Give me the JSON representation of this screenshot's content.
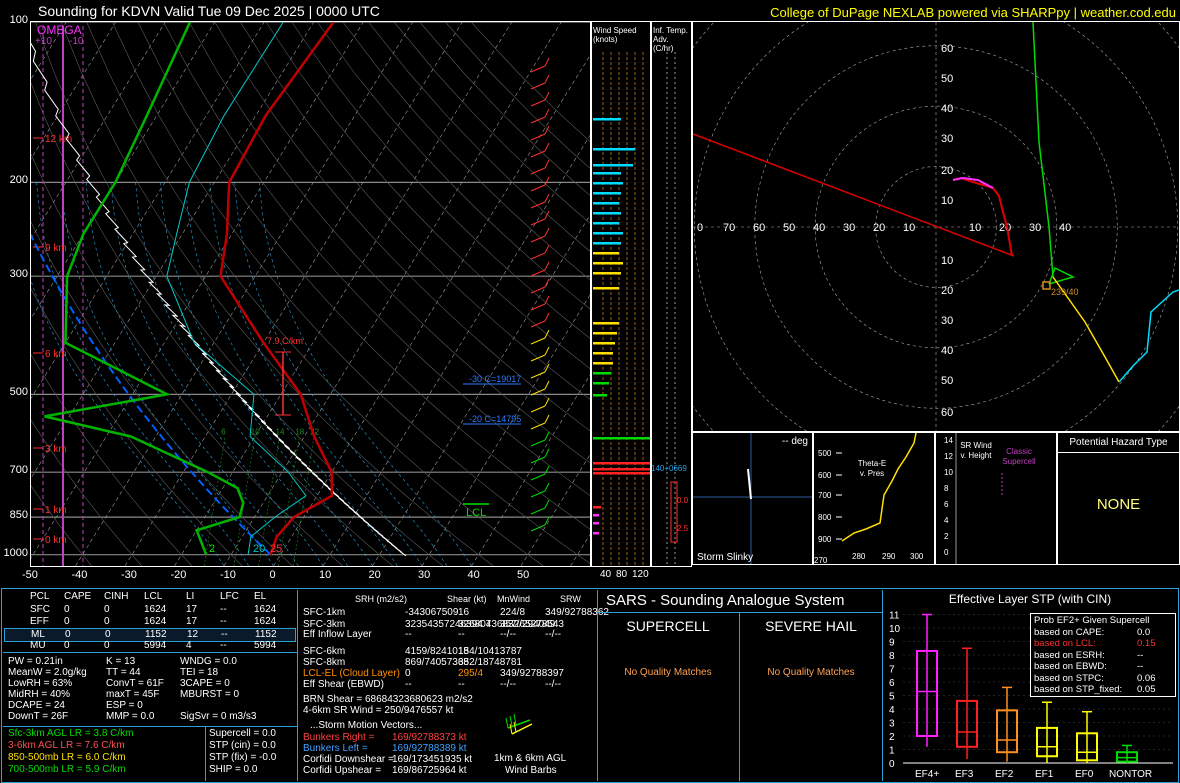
{
  "header": {
    "title": "Sounding for KDVN Valid  Tue 09 Dec 2025 | 0000 UTC",
    "credit": "College of DuPage NEXLAB powered via SHARPpy | weather.cod.edu"
  },
  "colors": {
    "temp": "#c00000",
    "dew": "#00b400",
    "wetbulb": "#00c8c8",
    "parcel": "#ffffff",
    "virtual": "#0060ff",
    "hodo_red": "#e00000",
    "hodo_magenta": "#ff30ff",
    "hodo_green": "#00dc00",
    "hodo_yellow": "#ffe000",
    "hodo_cyan": "#00dcff",
    "omega": "#c040c0",
    "credit": "#ffff00",
    "panel_border": "#2aa0d8"
  },
  "skewt": {
    "pressure_levels": [
      100,
      200,
      300,
      500,
      700,
      850,
      1000
    ],
    "pressure_labels": [
      "100",
      "200",
      "300",
      "500",
      "700",
      "850",
      "1000"
    ],
    "temp_ticks": [
      "-50",
      "-40",
      "-30",
      "-20",
      "-10",
      "0",
      "10",
      "20",
      "30",
      "40",
      "50"
    ],
    "height_labels": [
      "12 km",
      "9 km",
      "6 km",
      "3 km",
      "1 km",
      "0 km"
    ],
    "omega_label": "OMEGA",
    "omega_ticks": [
      "+10",
      "-10"
    ],
    "annotations": {
      "lapse": "7.9 C/km",
      "minus30": "-30 C=19017",
      "minus20": "-20 C=14795",
      "lcl": "LCL",
      "sfc_dew": "2",
      "sfc_wb": "20",
      "sfc_temp": "25"
    },
    "mixing_ratio_labels": [
      "6",
      "10",
      "14",
      "18",
      "22"
    ],
    "temperature": [
      [
        100,
        -56
      ],
      [
        150,
        -58
      ],
      [
        200,
        -57
      ],
      [
        250,
        -51
      ],
      [
        300,
        -47
      ],
      [
        400,
        -30
      ],
      [
        500,
        -16
      ],
      [
        600,
        -8
      ],
      [
        700,
        0
      ],
      [
        775,
        3
      ],
      [
        850,
        -2
      ],
      [
        925,
        -3
      ],
      [
        1000,
        -2
      ]
    ],
    "dewpoint": [
      [
        100,
        -85
      ],
      [
        150,
        -82
      ],
      [
        200,
        -80
      ],
      [
        250,
        -80
      ],
      [
        300,
        -78
      ],
      [
        400,
        -70
      ],
      [
        500,
        -43
      ],
      [
        550,
        -65
      ],
      [
        600,
        -45
      ],
      [
        700,
        -25
      ],
      [
        750,
        -17
      ],
      [
        800,
        -14
      ],
      [
        850,
        -13
      ],
      [
        900,
        -20
      ],
      [
        1000,
        -15
      ]
    ]
  },
  "side_strips": {
    "wind_speed_title": "Wind Speed (knots)",
    "wind_speed_ticks": [
      "40",
      "80",
      "120"
    ],
    "inf_temp_title": "Inf. Temp. Adv. (C/hr)",
    "inf_values": [
      "140+0669",
      "0.0",
      "2.5"
    ]
  },
  "hodograph": {
    "rings": [
      10,
      20,
      30,
      40,
      50,
      60,
      70
    ],
    "x_labels": [
      "0",
      "70",
      "60",
      "50",
      "40",
      "30",
      "20",
      "10",
      "10",
      "20",
      "30",
      "40"
    ],
    "y_labels": [
      "60",
      "50",
      "40",
      "30",
      "20",
      "10",
      "10",
      "20",
      "30",
      "40",
      "50",
      "60"
    ],
    "storm_label": "239/40"
  },
  "slinky": {
    "title": "-- deg",
    "label": "Storm Slinky"
  },
  "theta": {
    "title": "Theta-E v. Pres",
    "y_ticks": [
      "500",
      "600",
      "700",
      "800",
      "900"
    ],
    "x_ticks": [
      "280",
      "290",
      "300"
    ],
    "y_bottom": "1000",
    "y_bottom_partial": "270"
  },
  "srwind": {
    "title": "SR Wind v. Height",
    "label": "Classic Supercell",
    "y_ticks": [
      "14",
      "12",
      "10",
      "8",
      "6",
      "4",
      "2",
      "0"
    ]
  },
  "hazard": {
    "title": "Potential Hazard Type",
    "value": "NONE"
  },
  "parcel_table": {
    "headers": [
      "PCL",
      "CAPE",
      "CINH",
      "LCL",
      "LI",
      "LFC",
      "EL"
    ],
    "rows": [
      [
        "SFC",
        "0",
        "0",
        "1624",
        "17",
        "--",
        "1624"
      ],
      [
        "EFF",
        "0",
        "0",
        "1624",
        "17",
        "--",
        "1624"
      ],
      [
        "ML",
        "0",
        "0",
        "1152",
        "12",
        "--",
        "1152"
      ],
      [
        "MU",
        "0",
        "0",
        "5994",
        "4",
        "--",
        "5994"
      ]
    ]
  },
  "indices": [
    [
      "PW = 0.21in",
      "K = 13",
      "WNDG = 0.0"
    ],
    [
      "MeanW = 2.0g/kg",
      "TT = 44",
      "TEI = 18"
    ],
    [
      "LowRH = 63%",
      "ConvT = 61F",
      "3CAPE = 0"
    ],
    [
      "MidRH = 40%",
      "maxT = 45F",
      "MBURST = 0"
    ],
    [
      "DCAPE = 24",
      "ESP = 0",
      ""
    ],
    [
      "DownT = 26F",
      "MMP = 0.0",
      "SigSvr = 0 m3/s3"
    ]
  ],
  "lapse_rates": [
    {
      "text": "Sfc-3km AGL LR = 3.8 C/km",
      "color": "#00dc00"
    },
    {
      "text": "3-6km AGL LR = 7.6 C/km",
      "color": "#ff5050"
    },
    {
      "text": "850-500mb LR = 6.0 C/km",
      "color": "#ffe000"
    },
    {
      "text": "700-500mb LR = 5.9 C/km",
      "color": "#00dc00"
    }
  ],
  "composites": [
    "Supercell = 0.0",
    "STP (cin) = 0.0",
    "STP (fix) = -0.0",
    "SHIP = 0.0"
  ],
  "kinematics": {
    "headers": [
      "SRH (m2/s2)",
      "Shear (kt)",
      "MnWind",
      "SRW"
    ],
    "rows": [
      {
        "label": "SFC-1km",
        "c1": "-343067509",
        "c2": "16",
        "c3": "224/8",
        "c4": "349/92788362",
        "color": "#ffffff"
      },
      {
        "label": "SFC-3km",
        "c1": "32354357246394 7",
        "c2": "32680436832/294049",
        "c3": "357/65278543",
        "c4": "",
        "color": "#ffffff"
      },
      {
        "label": "Eff Inflow Layer",
        "c1": "--",
        "c2": "--",
        "c3": "--/--",
        "c4": "--/--",
        "color": "#ffffff"
      },
      {
        "label": "SFC-6km",
        "c1": "4159/8241018",
        "c2": "154/10413787",
        "c3": "",
        "c4": "",
        "color": "#ffffff"
      },
      {
        "label": "SFC-8km",
        "c1": "869/74057368",
        "c2": "352/18748781",
        "c3": "",
        "c4": "",
        "color": "#ffffff"
      },
      {
        "label": "LCL-EL (Cloud Layer)",
        "c1": "0",
        "c2": "295/4",
        "c3": "349/92788397",
        "c4": "",
        "color": "#ff9000"
      },
      {
        "label": "Eff Shear (EBWD)",
        "c1": "--",
        "c2": "--",
        "c3": "--/--",
        "c4": "--/--",
        "color": "#ffffff"
      }
    ],
    "brn": "BRN Shear = 68684323680623 m2/s2",
    "sr46": "4-6km SR Wind = 250/9476557 kt",
    "storm_title": "...Storm Motion Vectors...",
    "motions": [
      {
        "label": "Bunkers Right =",
        "value": "169/92788373 kt",
        "color": "#ff4040"
      },
      {
        "label": "Bunkers Left =",
        "value": "169/92788389 kt",
        "color": "#40a0ff"
      },
      {
        "label": "Corfidi Downshear =",
        "value": "169/173451935 kt",
        "color": "#ffffff"
      },
      {
        "label": "Corfidi Upshear =",
        "value": "169/86725964 kt",
        "color": "#ffffff"
      }
    ],
    "barbs_label_1": "1km & 6km AGL",
    "barbs_label_2": "Wind Barbs"
  },
  "sars": {
    "title": "SARS - Sounding Analogue System",
    "supercell": "SUPERCELL",
    "hail": "SEVERE HAIL",
    "no_match": "No Quality Matches"
  },
  "stp": {
    "title": "Effective Layer STP (with CIN)",
    "y_ticks": [
      "11",
      "10",
      "9",
      "8",
      "7",
      "6",
      "5",
      "4",
      "3",
      "2",
      "1",
      "0"
    ],
    "categories": [
      "EF4+",
      "EF3",
      "EF2",
      "EF1",
      "EF0",
      "NONTOR"
    ],
    "boxes": [
      {
        "cat": "EF4+",
        "lo": 1.2,
        "q1": 2.0,
        "med": 5.3,
        "q3": 8.3,
        "hi": 11.0,
        "color": "#ff20ff"
      },
      {
        "cat": "EF3",
        "lo": 0.3,
        "q1": 1.2,
        "med": 2.3,
        "q3": 4.6,
        "hi": 8.5,
        "color": "#ff2020"
      },
      {
        "cat": "EF2",
        "lo": 0.1,
        "q1": 0.8,
        "med": 1.7,
        "q3": 3.9,
        "hi": 5.6,
        "color": "#ff9020"
      },
      {
        "cat": "EF1",
        "lo": 0.0,
        "q1": 0.5,
        "med": 1.2,
        "q3": 2.6,
        "hi": 4.5,
        "color": "#ffff00"
      },
      {
        "cat": "EF0",
        "lo": 0.0,
        "q1": 0.2,
        "med": 0.8,
        "q3": 2.2,
        "hi": 3.8,
        "color": "#ffff00"
      },
      {
        "cat": "NONTOR",
        "lo": 0.0,
        "q1": 0.1,
        "med": 0.4,
        "q3": 0.8,
        "hi": 1.3,
        "color": "#00dc00"
      }
    ],
    "legend": [
      {
        "label": "Prob EF2+ Given Supercell",
        "value": "",
        "color": "#ffffff"
      },
      {
        "label": "based on CAPE:",
        "value": "0.0",
        "color": "#ffffff"
      },
      {
        "label": "based on LCL:",
        "value": "0.15",
        "color": "#ff3030"
      },
      {
        "label": "based on ESRH:",
        "value": "--",
        "color": "#ffffff"
      },
      {
        "label": "based on EBWD:",
        "value": "--",
        "color": "#ffffff"
      },
      {
        "label": "based on STPC:",
        "value": "0.06",
        "color": "#ffffff"
      },
      {
        "label": "based on STP_fixed:",
        "value": "0.05",
        "color": "#ffffff"
      }
    ]
  }
}
